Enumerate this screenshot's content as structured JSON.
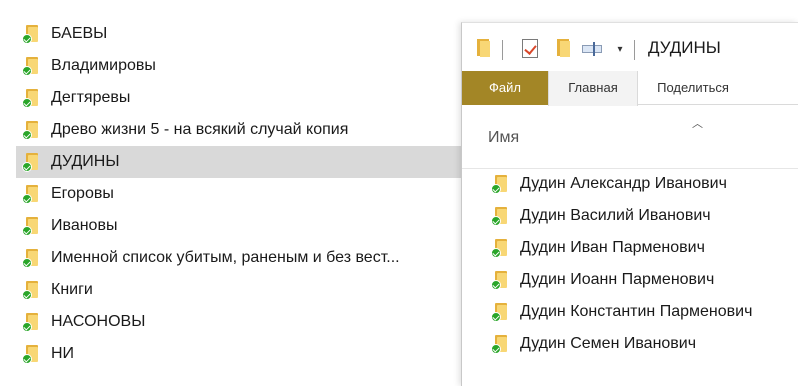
{
  "left_list": [
    {
      "label": "БАЕВЫ"
    },
    {
      "label": "Владимировы"
    },
    {
      "label": "Дегтяревы"
    },
    {
      "label": "Древо жизни 5 - на всякий случай копия"
    },
    {
      "label": "ДУДИНЫ",
      "selected": true
    },
    {
      "label": "Егоровы"
    },
    {
      "label": "Ивановы"
    },
    {
      "label": "Именной список убитым, раненым и без вест..."
    },
    {
      "label": "Книги"
    },
    {
      "label": "НАСОНОВЫ"
    },
    {
      "label": "НИ"
    }
  ],
  "explorer": {
    "title": "ДУДИНЫ",
    "dropdown_glyph": "▾",
    "tabs": {
      "file": "Файл",
      "home": "Главная",
      "share": "Поделиться"
    },
    "sort_glyph": "︿",
    "column_name": "Имя",
    "items": [
      {
        "label": "Дудин Александр Иванович"
      },
      {
        "label": "Дудин Василий Иванович"
      },
      {
        "label": "Дудин Иван Парменович"
      },
      {
        "label": "Дудин Иоанн Парменович"
      },
      {
        "label": "Дудин Константин Парменович"
      },
      {
        "label": "Дудин Семен Иванович"
      }
    ]
  },
  "colors": {
    "file_tab": "#a38626",
    "selection": "#d9d9d9",
    "folder": "#f8d775",
    "sync_check": "#2aa62a"
  }
}
